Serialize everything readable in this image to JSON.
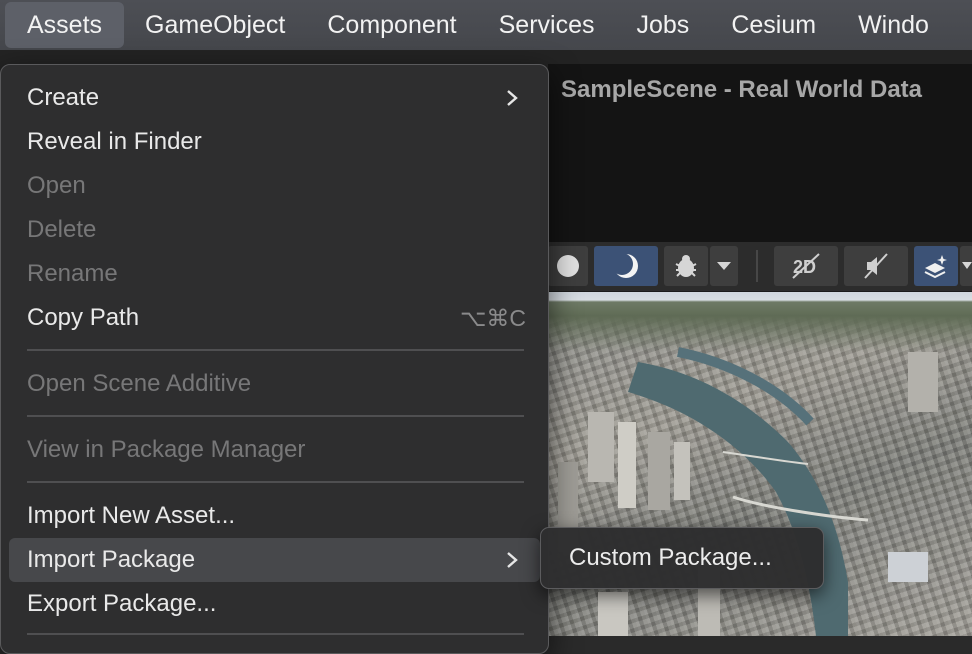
{
  "menubar": {
    "items": [
      {
        "label": "Assets",
        "active": true
      },
      {
        "label": "GameObject"
      },
      {
        "label": "Component"
      },
      {
        "label": "Services"
      },
      {
        "label": "Jobs"
      },
      {
        "label": "Cesium"
      },
      {
        "label": "Windo"
      }
    ]
  },
  "scene": {
    "title": "SampleScene - Real World Data"
  },
  "assets_menu": {
    "create": "Create",
    "reveal_in_finder": "Reveal in Finder",
    "open": "Open",
    "delete": "Delete",
    "rename": "Rename",
    "copy_path": "Copy Path",
    "copy_path_shortcut": "⌥⌘C",
    "open_scene_additive": "Open Scene Additive",
    "view_in_package_manager": "View in Package Manager",
    "import_new_asset": "Import New Asset...",
    "import_package": "Import Package",
    "export_package": "Export Package..."
  },
  "import_package_submenu": {
    "custom_package": "Custom Package..."
  },
  "colors": {
    "menu_bg": "#2e2e2f",
    "highlight": "#47484b",
    "toolbar_active": "#3c5276"
  }
}
